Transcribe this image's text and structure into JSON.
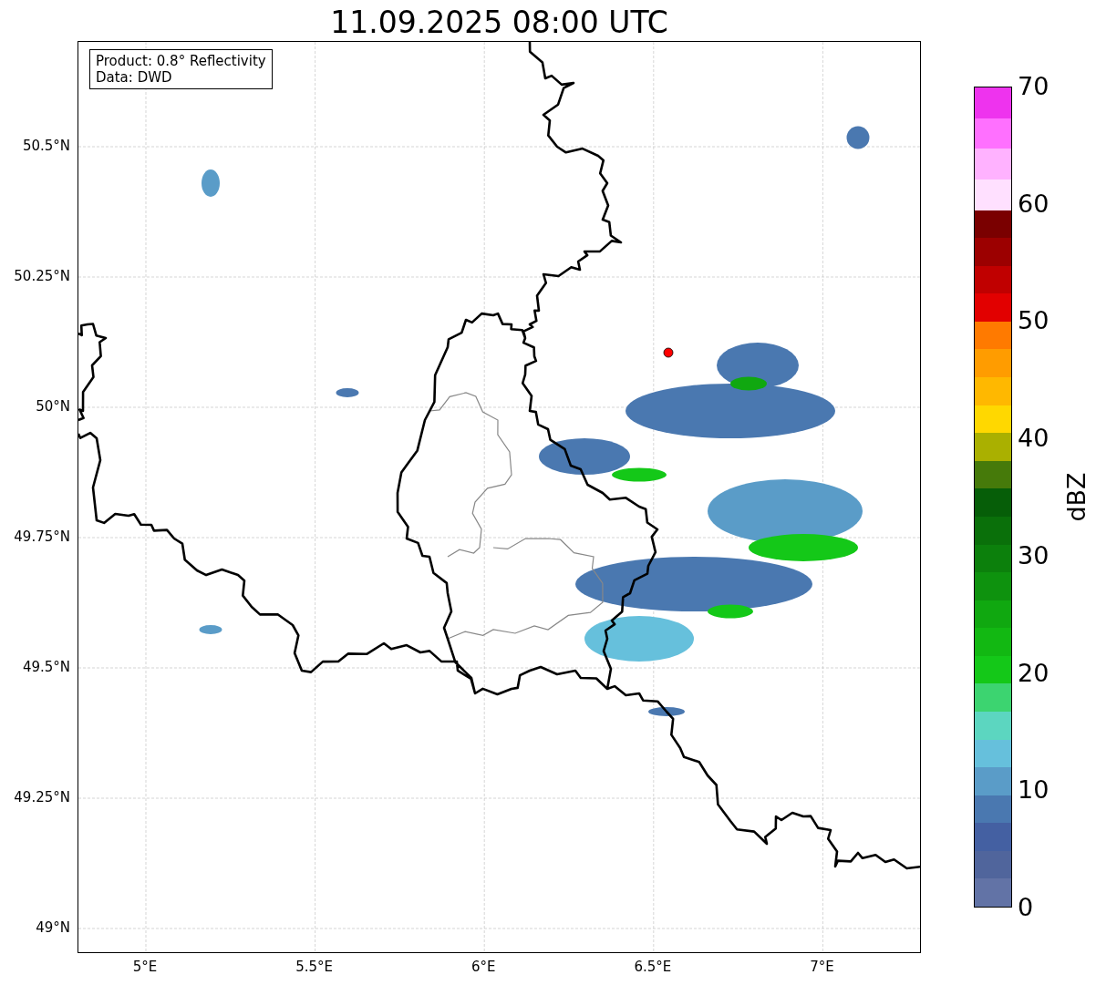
{
  "title": "11.09.2025 08:00 UTC",
  "map": {
    "info_box": [
      "Product: 0.8° Reflectivity",
      "Data: DWD"
    ],
    "y_ticks": [
      "50.5°N",
      "50.25°N",
      "50°N",
      "49.75°N",
      "49.5°N",
      "49.25°N",
      "49°N"
    ],
    "x_ticks": [
      "5°E",
      "5.5°E",
      "6°E",
      "6.5°E",
      "7°E"
    ]
  },
  "colorbar": {
    "label": "dBZ",
    "ticks": [
      "70",
      "60",
      "50",
      "40",
      "30",
      "20",
      "10",
      "0"
    ],
    "segments": [
      {
        "color": "#ee33ee"
      },
      {
        "color": "#ff70ff"
      },
      {
        "color": "#ffb2ff"
      },
      {
        "color": "#ffe0ff"
      },
      {
        "color": "#7a0000"
      },
      {
        "color": "#9c0000"
      },
      {
        "color": "#c00000"
      },
      {
        "color": "#e20000"
      },
      {
        "color": "#ff7a00"
      },
      {
        "color": "#ff9c00"
      },
      {
        "color": "#ffb800"
      },
      {
        "color": "#ffd800"
      },
      {
        "color": "#aab000"
      },
      {
        "color": "#467a0a"
      },
      {
        "color": "#065e08"
      },
      {
        "color": "#0a700a"
      },
      {
        "color": "#0c800c"
      },
      {
        "color": "#0e920e"
      },
      {
        "color": "#10a810"
      },
      {
        "color": "#12b812"
      },
      {
        "color": "#14c818"
      },
      {
        "color": "#3cd470"
      },
      {
        "color": "#5cd6c0"
      },
      {
        "color": "#66c0dc"
      },
      {
        "color": "#5a9cc8"
      },
      {
        "color": "#4a78b0"
      },
      {
        "color": "#4460a2"
      },
      {
        "color": "#50659c"
      },
      {
        "color": "#6273a6"
      }
    ]
  }
}
